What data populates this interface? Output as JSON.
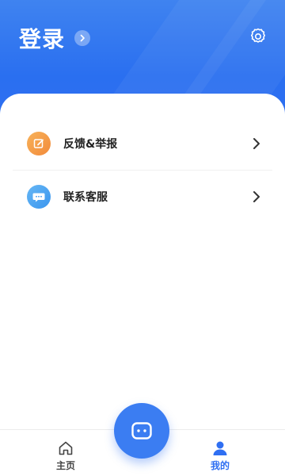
{
  "header": {
    "title": "登录",
    "title_arrow_icon": "chevron-right-icon",
    "settings_icon": "gear-icon"
  },
  "menu": {
    "items": [
      {
        "label": "反馈&举报",
        "icon": "edit-icon",
        "icon_color": "#f28a3a"
      },
      {
        "label": "联系客服",
        "icon": "chat-bubble-icon",
        "icon_color": "#3a95ee"
      }
    ]
  },
  "bottom_nav": {
    "items": [
      {
        "label": "主页",
        "icon": "home-icon",
        "active": false
      },
      {
        "label": "我的",
        "icon": "user-icon",
        "active": true
      }
    ],
    "fab_icon": "chat-icon"
  },
  "colors": {
    "accent": "#2f6ff2",
    "header_bg": "#3f83f0"
  }
}
